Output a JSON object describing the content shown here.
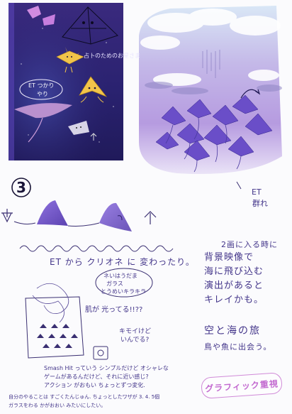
{
  "panel1": {
    "note_sign": "占卜のためのお星さま",
    "note_bubble_line1": "ET つかり",
    "note_bubble_line2": "やり"
  },
  "panel2": {
    "label_line1": "ET",
    "label_line2": "群れ",
    "note_line1": "2画に入る時に",
    "note_line2": "背景映像で",
    "note_line3": "海に飛び込む",
    "note_line4": "演出があると",
    "note_line5": "キレイかも。"
  },
  "section_number": "3",
  "transform_note": "ET から クリオネ に 変わったり。",
  "bubble_note_line1": "ネいはうだま",
  "bubble_note_line2": "ガラス",
  "bubble_note_line3": "とうめいキラキラ",
  "shine_note": "肌が 光ってる!!??",
  "kimoi_note_line1": "キモイけど",
  "kimoi_note_line2": "いんでる?",
  "sky_sea_line1": "空と海の旅",
  "sky_sea_line2": "鳥や魚に出会う。",
  "graphic_stamp": "グラフィック重視",
  "bottom_notes": {
    "line1": "Smash Hit っていう シンプルだけど オシャレな",
    "line2": "ゲームがあるんだけど、それに近い感じ?",
    "line3": "アクション がおもい ちょっとずつ変化.",
    "line4": "自分のやることは すごくたんじゅん. ちょっとしたワザが 3. 4. 5個",
    "line5": "ガラスをわる かがおおい みたいにしたい。"
  },
  "colors": {
    "night_sky": "#2a2470",
    "stingray": "#7a5ec8",
    "cloud_sky": "#c9c2ea",
    "ink": "#43358a",
    "stamp": "#c36bd0"
  }
}
